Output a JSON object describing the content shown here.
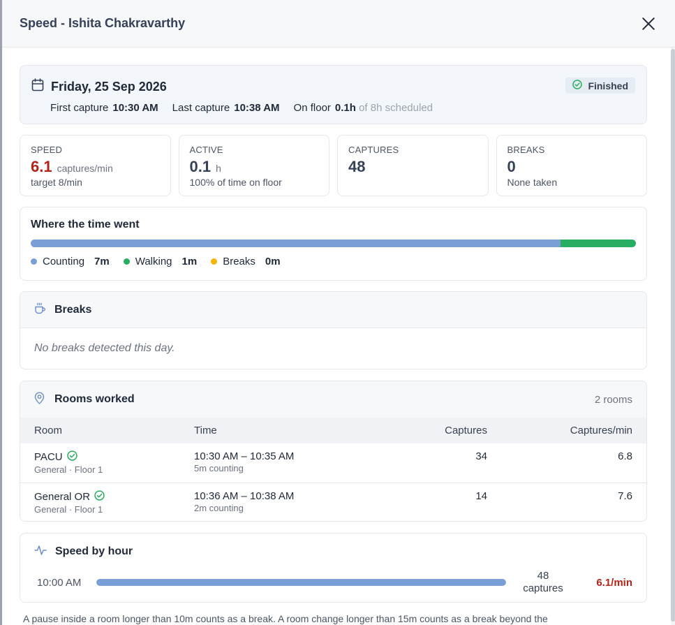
{
  "modal": {
    "title": "Speed - Ishita Chakravarthy"
  },
  "day": {
    "date": "Friday, 25 Sep 2026",
    "status": "Finished",
    "first_capture_label": "First capture",
    "first_capture": "10:30 AM",
    "last_capture_label": "Last capture",
    "last_capture": "10:38 AM",
    "on_floor_label": "On floor",
    "on_floor": "0.1h",
    "scheduled": "of 8h scheduled"
  },
  "stats": {
    "speed": {
      "label": "SPEED",
      "value": "6.1",
      "unit": "captures/min",
      "sub": "target 8/min"
    },
    "active": {
      "label": "ACTIVE",
      "value": "0.1",
      "unit": "h",
      "sub": "100% of time on floor"
    },
    "captures": {
      "label": "CAPTURES",
      "value": "48"
    },
    "breaks": {
      "label": "BREAKS",
      "value": "0",
      "sub": "None taken"
    }
  },
  "time_breakdown": {
    "title": "Where the time went",
    "segments": [
      {
        "label": "Counting",
        "value": "7m",
        "minutes": 7,
        "color": "#7a9ed6"
      },
      {
        "label": "Walking",
        "value": "1m",
        "minutes": 1,
        "color": "#27ae60"
      },
      {
        "label": "Breaks",
        "value": "0m",
        "minutes": 0,
        "color": "#f5b400"
      }
    ]
  },
  "breaks": {
    "title": "Breaks",
    "empty_text": "No breaks detected this day."
  },
  "rooms": {
    "title": "Rooms worked",
    "count": "2 rooms",
    "headers": {
      "room": "Room",
      "time": "Time",
      "captures": "Captures",
      "rate": "Captures/min"
    },
    "rows": [
      {
        "name": "PACU",
        "location": "General · Floor 1",
        "time": "10:30 AM – 10:35 AM",
        "duration": "5m counting",
        "captures": "34",
        "rate": "6.8"
      },
      {
        "name": "General OR",
        "location": "General · Floor 1",
        "time": "10:36 AM – 10:38 AM",
        "duration": "2m counting",
        "captures": "14",
        "rate": "7.6"
      }
    ]
  },
  "hourly": {
    "title": "Speed by hour",
    "rows": [
      {
        "hour": "10:00 AM",
        "captures_num": "48",
        "captures_word": "captures",
        "rate": "6.1/min",
        "fill_fraction": 1.0
      }
    ]
  },
  "footnote": "A pause inside a room longer than 10m counts as a break. A room change longer than 15m counts as a break beyond the"
}
